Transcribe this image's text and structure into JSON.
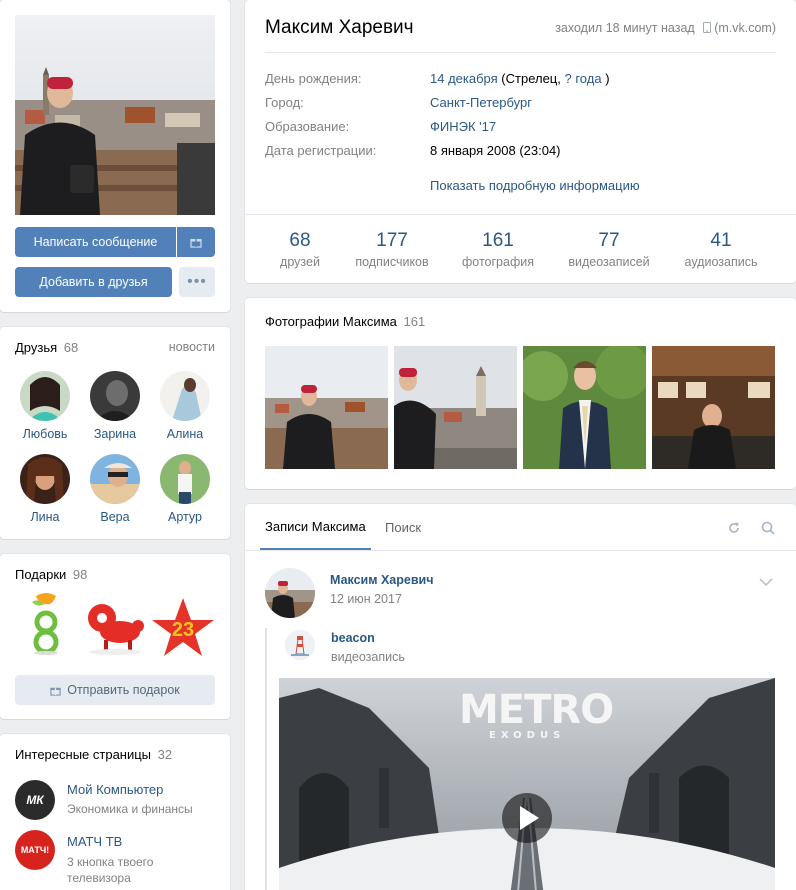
{
  "profile": {
    "name": "Максим Харевич",
    "last_seen": "заходил 18 минут назад",
    "last_seen_source": "(m.vk.com)",
    "fields": [
      {
        "label": "День рождения:",
        "value": "14 декабря",
        "extra": "(Стрелец,",
        "extra_link": "? года",
        "extra_end": ")"
      },
      {
        "label": "Город:",
        "value": "Санкт-Петербург"
      },
      {
        "label": "Образование:",
        "value": "ФИНЭК '17"
      },
      {
        "label": "Дата регистрации:",
        "value": "8 января 2008 (23:04)"
      }
    ],
    "show_more": "Показать подробную информацию",
    "stats": [
      {
        "count": "68",
        "label": "друзей"
      },
      {
        "count": "177",
        "label": "подписчиков"
      },
      {
        "count": "161",
        "label": "фотография"
      },
      {
        "count": "77",
        "label": "видеозаписей"
      },
      {
        "count": "41",
        "label": "аудиозапись"
      }
    ]
  },
  "actions": {
    "message": "Написать сообщение",
    "add_friend": "Добавить в друзья",
    "gift_icon": "gift-icon",
    "more_icon": "more-dots-icon"
  },
  "friends": {
    "title": "Друзья",
    "count": "68",
    "news_link": "новости",
    "items": [
      {
        "name": "Любовь"
      },
      {
        "name": "Зарина"
      },
      {
        "name": "Алина"
      },
      {
        "name": "Лина"
      },
      {
        "name": "Вера"
      },
      {
        "name": "Артур"
      }
    ]
  },
  "gifts": {
    "title": "Подарки",
    "count": "98",
    "send_button": "Отправить подарок"
  },
  "pages": {
    "title": "Интересные страницы",
    "count": "32",
    "items": [
      {
        "name": "Мой Компьютер",
        "desc": "Экономика и финансы",
        "logo": "МК"
      },
      {
        "name": "МАТЧ ТВ",
        "desc": "3 кнопка твоего телевизора",
        "logo": "МАТЧ!"
      }
    ]
  },
  "photos": {
    "title": "Фотографии Максима",
    "count": "161"
  },
  "wall": {
    "tab_posts": "Записи Максима",
    "tab_search": "Поиск",
    "post": {
      "author": "Максим Харевич",
      "date": "12 июн 2017",
      "repost_author": "beacon",
      "repost_type": "видеозапись",
      "video_title_main": "METRO",
      "video_title_sub": "EXODUS"
    }
  },
  "colors": {
    "accent": "#5181b8",
    "link": "#2a5885",
    "background": "#edeef0"
  }
}
